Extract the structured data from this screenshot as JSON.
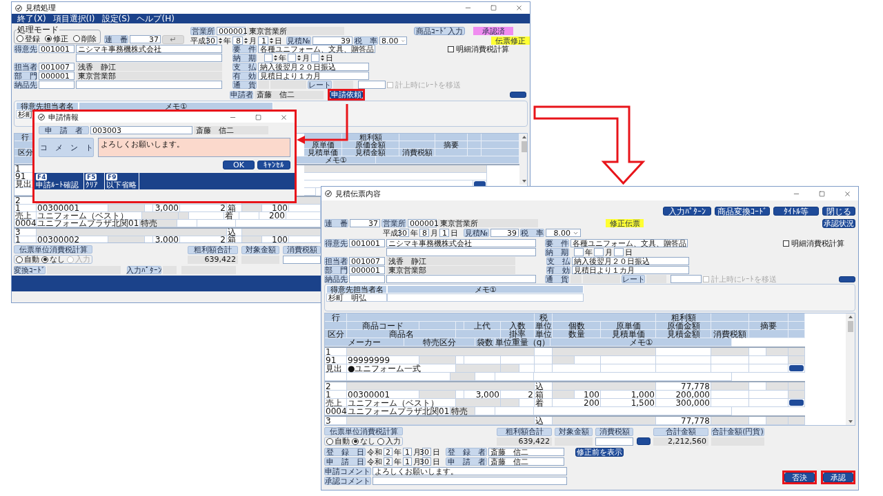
{
  "left_window": {
    "title": "見積処理",
    "menu": [
      "終了(X)",
      "項目選択(I)",
      "設定(S)",
      "ヘルプ(H)"
    ],
    "mode": {
      "title": "処理モード",
      "options": [
        {
          "label": "登録",
          "selected": false
        },
        {
          "label": "修正",
          "selected": true
        },
        {
          "label": "削除",
          "selected": false
        }
      ]
    },
    "serial": {
      "label": "連　番",
      "value": "37"
    },
    "enter_button": {
      "label": "↵",
      "disabled": true
    },
    "office": {
      "label": "営業所",
      "code": "000001",
      "name": "東京営業所"
    },
    "date": {
      "era": "平成",
      "parts": [
        {
          "value": "30",
          "unit": "年"
        },
        {
          "value": "8",
          "unit": "月"
        },
        {
          "value": "1",
          "unit": "日"
        }
      ]
    },
    "estimate_no": {
      "label": "見積№",
      "value": "39"
    },
    "tax_rate": {
      "label": "税　率",
      "value": "8.00"
    },
    "product_code_button": "商品ｺｰﾄﾞ入力",
    "badges": [
      {
        "text": "承認済",
        "color": "#f08cf0"
      },
      {
        "text": "伝票修正",
        "color": "#ffff33"
      }
    ],
    "customer": {
      "label": "得意先",
      "code": "001001",
      "name": "ニシマキ事務機株式会社"
    },
    "requirement": {
      "label": "要　件",
      "value": "各種ユニフォーム、文具、贈答品"
    },
    "detail_tax": {
      "label": "明細消費税計算",
      "checked": false
    },
    "delivery": {
      "label": "納　期",
      "units": [
        "年",
        "月",
        "日"
      ]
    },
    "staff": {
      "label": "担当者",
      "code": "001007",
      "name": "浅香　静江"
    },
    "payment": {
      "label": "支　払",
      "value": "納入後翌月２０日振込"
    },
    "dept": {
      "label": "部　門",
      "code": "000001",
      "name": "東京営業部"
    },
    "validity": {
      "label": "有　効",
      "value": "見積日より１カ月"
    },
    "ship_to": {
      "label": "納品先"
    },
    "currency": {
      "label": "通　貨"
    },
    "rate": {
      "label": "レート"
    },
    "rate_transfer": {
      "label": "計上時にﾚｰﾄを移送",
      "checked": false,
      "disabled": true
    },
    "applicant": {
      "label": "申請者",
      "name": "斎藤　信二"
    },
    "request_button": "申請依頼",
    "contact": {
      "columns": [
        "得意先担当者名",
        "メモ①"
      ],
      "name": "杉町"
    },
    "table": {
      "header": [
        [
          "行",
          "粗利額"
        ],
        [
          "原単価",
          "原価金額",
          "摘要"
        ],
        [
          "区分",
          "見積単価",
          "見積金額",
          "消費税額"
        ],
        [
          "メモ①"
        ]
      ],
      "rows": [
        {
          "heading_line": [
            "1"
          ],
          "code_line": [
            "91"
          ],
          "name_line": [
            "見出"
          ]
        },
        {
          "heading_line": [
            "2"
          ],
          "code_line": [
            "1",
            "00300001",
            "3,000",
            "2",
            "箱",
            "100"
          ],
          "name_line": [
            "売上",
            "ユニフォーム（ベスト）",
            "着",
            "200"
          ],
          "maker_line": [
            "0004",
            "ユニフォームプラザ北関01",
            "特売"
          ]
        },
        {
          "heading_line": [
            "3",
            "込"
          ],
          "code_line": [
            "1",
            "00300002",
            "3,000",
            "2",
            "箱",
            "100"
          ]
        }
      ]
    },
    "footer": {
      "tax_calc": {
        "title": "伝票単位消費税計算",
        "options": [
          {
            "label": "自動",
            "selected": false,
            "disabled": false
          },
          {
            "label": "なし",
            "selected": true,
            "disabled": false
          },
          {
            "label": "入力",
            "selected": false,
            "disabled": true
          }
        ]
      },
      "totals": [
        {
          "label": "粗利額合計",
          "value": "639,422",
          "kind": "readonly"
        },
        {
          "label": "対象金額",
          "kind": "readonly"
        },
        {
          "label": "消費税額",
          "kind": "input"
        }
      ],
      "conversion_code": {
        "label": "変換ｺｰﾄﾞ"
      },
      "input_pattern": {
        "label": "入力ﾊﾟﾀｰﾝ"
      }
    }
  },
  "dialog": {
    "title": "申請情報",
    "applicant": {
      "label": "申　請　者",
      "code": "003003",
      "name": "斎藤　信二"
    },
    "comment": {
      "label": "コ　メ　ン　ト",
      "value": "よろしくお願いします。"
    },
    "buttons": [
      "OK",
      "ｷｬﾝｾﾙ"
    ],
    "function_keys": [
      {
        "key": "F4",
        "label": "申請ﾙｰﾄ確認"
      },
      {
        "key": "F5",
        "label": "ｸﾘｱ"
      },
      {
        "key": "F9",
        "label": "以下省略"
      }
    ]
  },
  "right_window": {
    "title": "見積伝票内容",
    "toolbar": [
      "入力ﾊﾟﾀｰﾝ",
      "商品変換ｺｰﾄﾞ",
      "ﾀｲﾄﾙ等",
      "閉じる"
    ],
    "approval_status_button": "承認状況",
    "serial": {
      "label": "連　番",
      "value": "37"
    },
    "office": {
      "label": "営業所",
      "code": "000001",
      "name": "東京営業所"
    },
    "badge": {
      "text": "修正伝票",
      "color": "#ffff33"
    },
    "date": {
      "era": "平成",
      "parts": [
        {
          "value": "30",
          "unit": "年"
        },
        {
          "value": "8",
          "unit": "月"
        },
        {
          "value": "1",
          "unit": "日"
        }
      ]
    },
    "estimate_no": {
      "label": "見積№",
      "value": "39"
    },
    "tax_rate": {
      "label": "税　率",
      "value": "8.00"
    },
    "customer": {
      "label": "得意先",
      "code": "001001",
      "name": "ニシマキ事務機株式会社"
    },
    "requirement": {
      "label": "要　件",
      "value": "各種ユニフォーム、文具、贈答品"
    },
    "detail_tax": {
      "label": "明細消費税計算",
      "checked": false
    },
    "delivery": {
      "label": "納　期",
      "units": [
        "年",
        "月",
        "日"
      ]
    },
    "staff": {
      "label": "担当者",
      "code": "001007",
      "name": "浅香　静江"
    },
    "payment": {
      "label": "支　払",
      "value": "納入後翌月２０日振込"
    },
    "dept": {
      "label": "部　門",
      "code": "000001",
      "name": "東京営業部"
    },
    "validity": {
      "label": "有　効",
      "value": "見積日より１カ月"
    },
    "ship_to": {
      "label": "納品先"
    },
    "currency": {
      "label": "通　貨"
    },
    "rate": {
      "label": "レート"
    },
    "rate_transfer": {
      "label": "計上時にﾚｰﾄを移送",
      "checked": false,
      "disabled": true
    },
    "contact": {
      "columns": [
        "得意先担当者名",
        "メモ①"
      ],
      "name": "杉町　明弘"
    },
    "table": {
      "header": [
        [
          "行",
          "税",
          "粗利額"
        ],
        [
          "商品コード",
          "上代",
          "入数",
          "単位",
          "個数",
          "原単価",
          "原価金額",
          "摘要"
        ],
        [
          "区分",
          "商品名",
          "掛率",
          "単位",
          "数量",
          "見積単価",
          "見積金額",
          "消費税額"
        ],
        [
          "メーカー",
          "特売区分",
          "袋数",
          "単位重量（g）",
          "メモ①"
        ]
      ],
      "rows": [
        {
          "heading_line": [
            "1"
          ],
          "code_line": [
            "91",
            "99999999"
          ],
          "name_line": [
            "見出",
            "●ユニフォーム一式"
          ]
        },
        {
          "heading_line": [
            "2",
            "込",
            "77,778"
          ],
          "code_line": [
            "1",
            "00300001",
            "3,000",
            "2",
            "箱",
            "100",
            "1,000",
            "200,000"
          ],
          "name_line": [
            "売上",
            "ユニフォーム（ベスト）",
            "着",
            "200",
            "1,500",
            "300,000"
          ],
          "maker_line": [
            "0004",
            "ユニフォームプラザ北関01",
            "特売"
          ]
        },
        {
          "heading_line": [
            "3",
            "込",
            "77,778"
          ]
        }
      ]
    },
    "footer": {
      "tax_calc": {
        "title": "伝票単位消費税計算",
        "options": [
          {
            "label": "自動",
            "selected": false
          },
          {
            "label": "なし",
            "selected": true
          },
          {
            "label": "入力",
            "selected": false
          }
        ]
      },
      "totals": [
        {
          "label": "粗利額合計",
          "value": "639,422",
          "kind": "readonly"
        },
        {
          "label": "対象金額",
          "kind": "readonly"
        },
        {
          "label": "消費税額",
          "kind": "input_with_button"
        },
        {
          "label": "合計金額",
          "value": "2,212,560",
          "kind": "readonly"
        },
        {
          "label": "合計金額(円貨)",
          "kind": "readonly"
        }
      ],
      "registered": {
        "label": "登　録　日",
        "era": "令和",
        "parts": [
          {
            "value": "2",
            "unit": "年"
          },
          {
            "value": "1",
            "unit": "月"
          },
          {
            "value": "30",
            "unit": "日"
          }
        ],
        "by_label": "登　録　者",
        "by": "斎藤　信二"
      },
      "requested": {
        "label": "申　請　日",
        "era": "令和",
        "parts": [
          {
            "value": "2",
            "unit": "年"
          },
          {
            "value": "1",
            "unit": "月"
          },
          {
            "value": "30",
            "unit": "日"
          }
        ],
        "by_label": "申　請　者",
        "by": "斎藤　信二"
      },
      "show_before_button": "修正前を表示",
      "request_comment": {
        "label": "申請コメント",
        "value": "よろしくお願いします。"
      },
      "approval_comment": {
        "label": "承認コメント"
      },
      "actions": [
        "否決",
        "承認"
      ]
    }
  }
}
